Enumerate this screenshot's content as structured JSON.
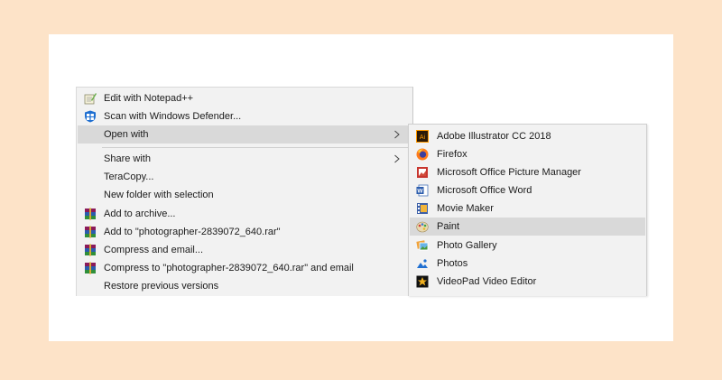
{
  "context_menu": {
    "items": [
      {
        "label": "Edit with Notepad++",
        "icon": "notepadpp-icon"
      },
      {
        "label": "Scan with Windows Defender...",
        "icon": "windows-defender-icon"
      },
      {
        "label": "Open with",
        "icon": "",
        "has_submenu": true,
        "highlighted": true
      },
      {
        "label": "Share with",
        "icon": "",
        "has_submenu": true
      },
      {
        "label": "TeraCopy...",
        "icon": ""
      },
      {
        "label": "New folder with selection",
        "icon": ""
      },
      {
        "label": "Add to archive...",
        "icon": "winrar-icon"
      },
      {
        "label": "Add to \"photographer-2839072_640.rar\"",
        "icon": "winrar-icon"
      },
      {
        "label": "Compress and email...",
        "icon": "winrar-icon"
      },
      {
        "label": "Compress to \"photographer-2839072_640.rar\" and email",
        "icon": "winrar-icon"
      },
      {
        "label": "Restore previous versions",
        "icon": ""
      }
    ]
  },
  "open_with_submenu": {
    "items": [
      {
        "label": "Adobe Illustrator CC 2018",
        "icon": "adobe-illustrator-icon"
      },
      {
        "label": "Firefox",
        "icon": "firefox-icon"
      },
      {
        "label": "Microsoft Office Picture Manager",
        "icon": "picture-manager-icon"
      },
      {
        "label": "Microsoft Office Word",
        "icon": "word-icon"
      },
      {
        "label": "Movie Maker",
        "icon": "movie-maker-icon"
      },
      {
        "label": "Paint",
        "icon": "paint-icon",
        "highlighted": true
      },
      {
        "label": "Photo Gallery",
        "icon": "photo-gallery-icon"
      },
      {
        "label": "Photos",
        "icon": "photos-icon"
      },
      {
        "label": "VideoPad Video Editor",
        "icon": "videopad-icon"
      }
    ]
  },
  "colors": {
    "page_background": "#fde3c8",
    "menu_background": "#f2f2f2",
    "highlight": "#d9d9d9"
  }
}
